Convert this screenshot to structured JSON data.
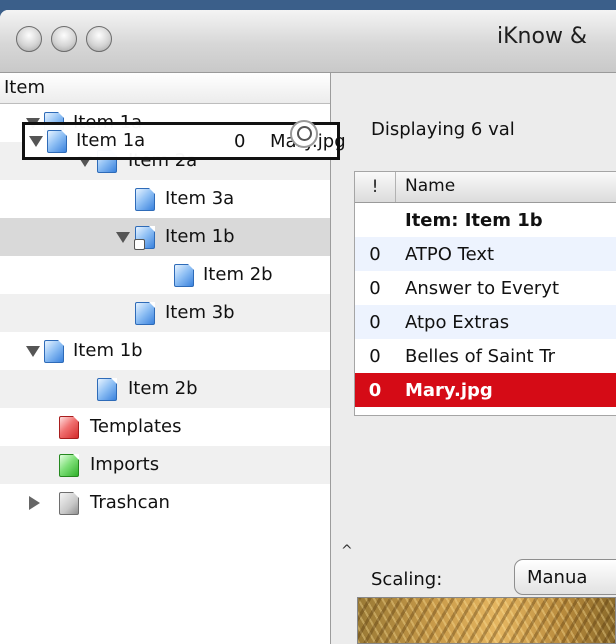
{
  "window": {
    "title": "iKnow &"
  },
  "sidebar": {
    "header": "Item",
    "items": [
      {
        "label": "Item 1a",
        "icon": "document-icon-blue",
        "expanded": true
      },
      {
        "label": "Item 2a",
        "icon": "document-icon-blue",
        "expanded": true
      },
      {
        "label": "Item 3a",
        "icon": "document-icon-blue"
      },
      {
        "label": "Item 1b",
        "icon": "alias-document-icon-blue",
        "expanded": true,
        "selected": true
      },
      {
        "label": "Item 2b",
        "icon": "document-icon-blue"
      },
      {
        "label": "Item 3b",
        "icon": "document-icon-blue"
      },
      {
        "label": "Item 1b",
        "icon": "document-icon-blue",
        "expanded": true
      },
      {
        "label": "Item 2b",
        "icon": "document-icon-blue"
      },
      {
        "label": "Templates",
        "icon": "document-icon-red"
      },
      {
        "label": "Imports",
        "icon": "document-icon-green"
      },
      {
        "label": "Trashcan",
        "icon": "trash-icon",
        "expanded": false
      }
    ]
  },
  "drag_overlay": {
    "label": "Item 1a",
    "value": "0",
    "name": "Mary.jpg"
  },
  "main": {
    "display_text": "Displaying 6 val",
    "table": {
      "headers": [
        "!",
        "Name"
      ],
      "rows": [
        {
          "flag": "",
          "name": "Item: Item 1b",
          "bold": true
        },
        {
          "flag": "0",
          "name": "ATPO Text"
        },
        {
          "flag": "0",
          "name": "Answer to Everyt"
        },
        {
          "flag": "0",
          "name": "Atpo Extras"
        },
        {
          "flag": "0",
          "name": "Belles of Saint Tr"
        },
        {
          "flag": "0",
          "name": "Mary.jpg",
          "selected": true
        }
      ]
    },
    "scaling_label": "Scaling:",
    "scaling_value": "Manua",
    "colors": {
      "selection_red": "#d50b16",
      "alt_row_blue": "#edf3fe"
    }
  }
}
